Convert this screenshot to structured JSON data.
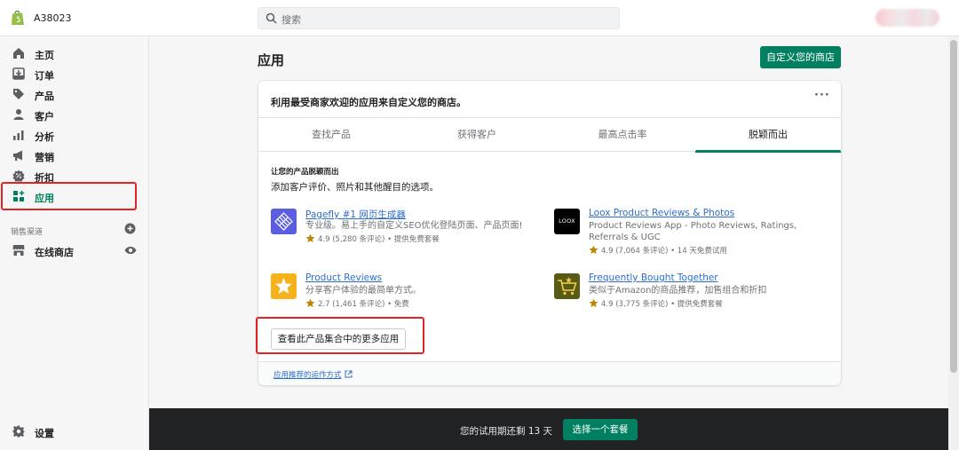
{
  "topbar": {
    "store_name": "A38023",
    "search_placeholder": "搜索",
    "logo_icon": "shopify-bag-icon"
  },
  "sidebar": {
    "items": [
      {
        "label": "主页",
        "icon": "home-icon"
      },
      {
        "label": "订单",
        "icon": "orders-icon"
      },
      {
        "label": "产品",
        "icon": "tag-icon"
      },
      {
        "label": "客户",
        "icon": "customer-icon"
      },
      {
        "label": "分析",
        "icon": "analytics-icon"
      },
      {
        "label": "营销",
        "icon": "megaphone-icon"
      },
      {
        "label": "折扣",
        "icon": "discount-icon"
      },
      {
        "label": "应用",
        "icon": "apps-icon",
        "active": true
      }
    ],
    "channels_label": "销售渠道",
    "online_store": "在线商店",
    "settings": "设置"
  },
  "main": {
    "title": "应用",
    "customize_button": "自定义您的商店",
    "card": {
      "title": "利用最受商家欢迎的应用来自定义您的商店。",
      "tabs": [
        "查找产品",
        "获得客户",
        "最高点击率",
        "脱颖而出"
      ],
      "active_tab": "脱颖而出",
      "section_heading": "让您的产品脱颖而出",
      "section_desc": "添加客户评价、照片和其他醒目的选项。",
      "apps": [
        {
          "name": "Pagefly #1 网页生成器",
          "desc": "专业级。易上手的自定义SEO优化登陆页面、产品页面!",
          "meta": "4.9 (5,280 条评论) • 提供免费套餐"
        },
        {
          "name": "Loox Product Reviews & Photos",
          "desc": "Product Reviews App - Photo Reviews, Ratings, Referrals & UGC",
          "meta": "4.9 (7,064 条评论) • 14 天免费试用",
          "icon_text": "LOOX"
        },
        {
          "name": "Product Reviews",
          "desc": "分享客户体验的最简单方式。",
          "meta": "2.7 (1,461 条评论) • 免费"
        },
        {
          "name": "Frequently Bought Together",
          "desc": "类似于Amazon的商品推荐，加售组合和折扣",
          "meta": "4.9 (3,775 条评论) • 提供免费套餐"
        }
      ],
      "more_apps_button": "查看此产品集合中的更多应用",
      "footer_link": "应用推荐的运作方式"
    }
  },
  "trial": {
    "text": "您的试用期还剩 13 天",
    "button": "选择一个套餐"
  },
  "colors": {
    "accent": "#008060",
    "link": "#2c6ecb",
    "highlight": "#e02424",
    "dark_bar": "#202223"
  }
}
